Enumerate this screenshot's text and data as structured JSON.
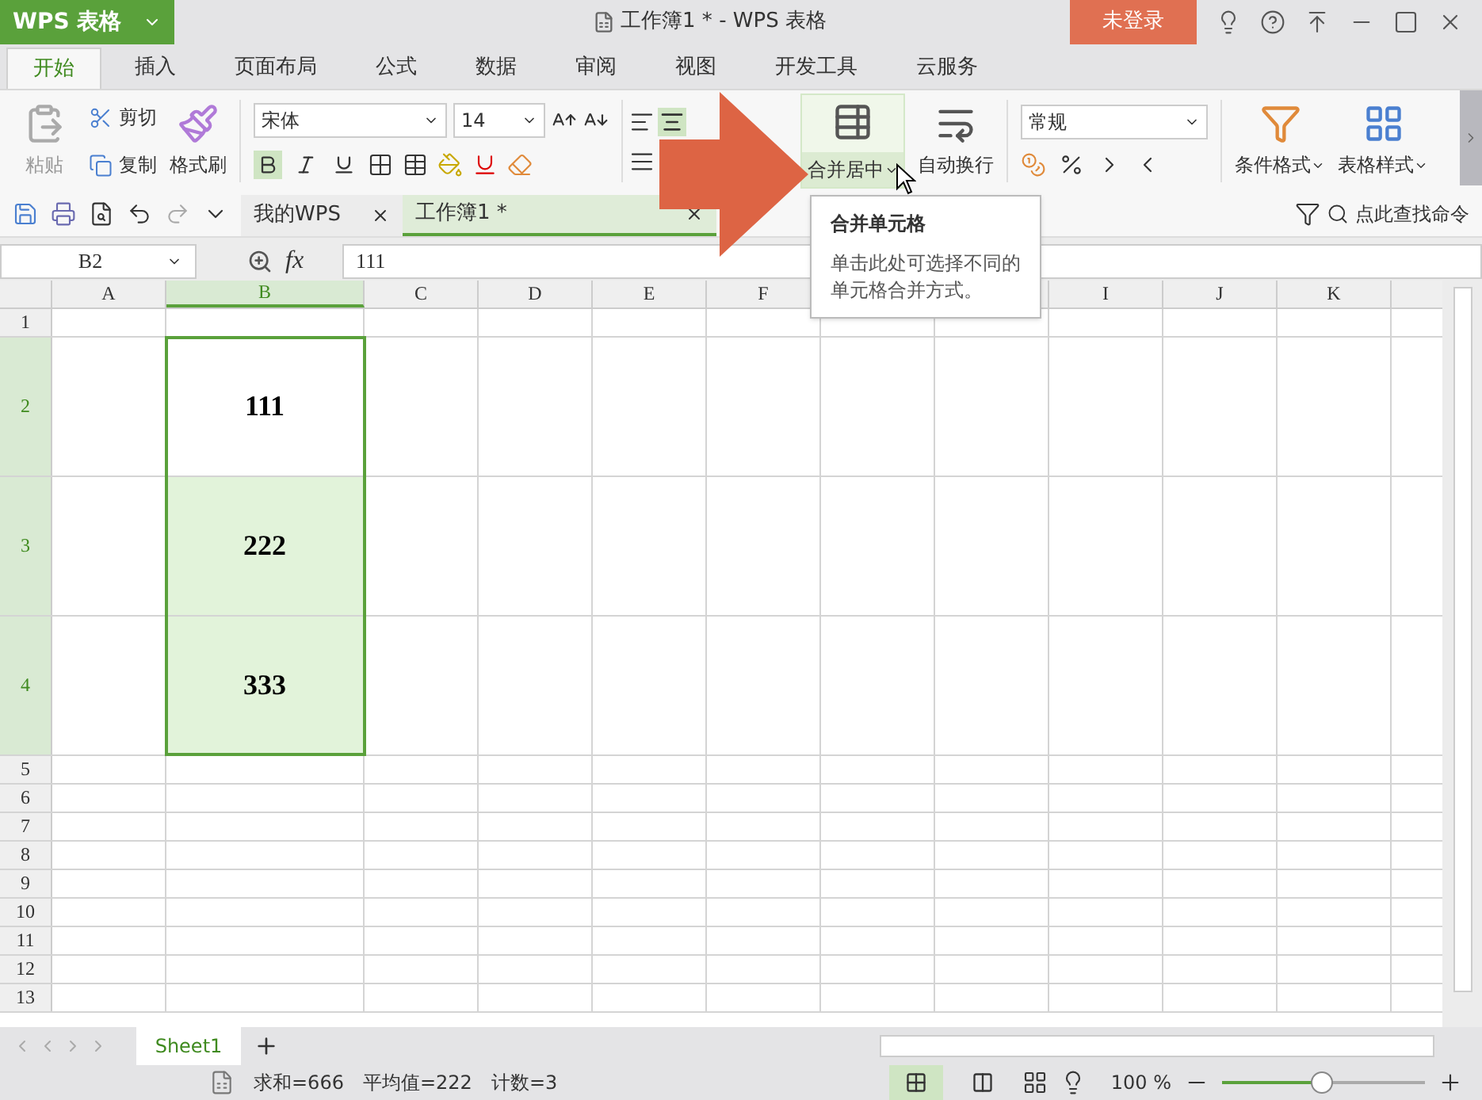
{
  "app_menu": {
    "label": "WPS 表格"
  },
  "window": {
    "title": "工作簿1 * - WPS 表格"
  },
  "login_button": "未登录",
  "ribbon_tabs": [
    {
      "label": "开始",
      "selected": true
    },
    {
      "label": "插入",
      "selected": false
    },
    {
      "label": "页面布局",
      "selected": false
    },
    {
      "label": "公式",
      "selected": false
    },
    {
      "label": "数据",
      "selected": false
    },
    {
      "label": "审阅",
      "selected": false
    },
    {
      "label": "视图",
      "selected": false
    },
    {
      "label": "开发工具",
      "selected": false
    },
    {
      "label": "云服务",
      "selected": false
    }
  ],
  "clipboard": {
    "paste": {
      "label": "粘贴",
      "disabled": true
    },
    "cut": "剪切",
    "copy": "复制",
    "format_painter": "格式刷"
  },
  "font": {
    "name": "宋体",
    "size": "14",
    "bold": true,
    "italic": false,
    "underline": false
  },
  "merge_button": {
    "label": "合并居中",
    "hovered": true
  },
  "wrap_button": "自动换行",
  "number_format": "常规",
  "conditional_format": "条件格式",
  "table_style": "表格样式",
  "doc_tabs": [
    {
      "label": "我的WPS",
      "selected": false
    },
    {
      "label": "工作簿1 *",
      "selected": true
    }
  ],
  "command_search": "点此查找命令",
  "name_box": "B2",
  "fx": "fx",
  "formula": "111",
  "tooltip": {
    "title": "合并单元格",
    "lines": [
      "单击此处可选择不同的",
      "单元格合并方式。"
    ]
  },
  "columns": [
    {
      "label": "A",
      "selected": false
    },
    {
      "label": "B",
      "selected": true
    },
    {
      "label": "C",
      "selected": false
    },
    {
      "label": "D",
      "selected": false
    },
    {
      "label": "E",
      "selected": false
    },
    {
      "label": "F",
      "selected": false
    },
    {},
    {},
    {
      "label": "I",
      "selected": false
    },
    {
      "label": "J",
      "selected": false
    },
    {
      "label": "K",
      "selected": false
    }
  ],
  "rows": [
    {
      "label": "1",
      "selected": false,
      "tall": false
    },
    {
      "label": "2",
      "selected": true,
      "tall": true,
      "b": {
        "value": "111",
        "active": true
      }
    },
    {
      "label": "3",
      "selected": true,
      "tall": true,
      "b": {
        "value": "222",
        "active": false
      }
    },
    {
      "label": "4",
      "selected": true,
      "tall": true,
      "b": {
        "value": "333",
        "active": false
      }
    },
    {
      "label": "5",
      "selected": false,
      "tall": false
    },
    {
      "label": "6",
      "selected": false,
      "tall": false
    },
    {
      "label": "7",
      "selected": false,
      "tall": false
    },
    {
      "label": "8",
      "selected": false,
      "tall": false
    },
    {
      "label": "9",
      "selected": false,
      "tall": false
    },
    {
      "label": "10",
      "selected": false,
      "tall": false
    },
    {
      "label": "11",
      "selected": false,
      "tall": false
    },
    {
      "label": "12",
      "selected": false,
      "tall": false
    },
    {
      "label": "13",
      "selected": false,
      "tall": false
    }
  ],
  "sheet_tabs": [
    {
      "label": "Sheet1",
      "selected": true
    }
  ],
  "status": {
    "items": [
      "求和=666",
      "平均值=222",
      "计数=3"
    ],
    "views": [
      {
        "selected": true
      },
      {
        "selected": false
      }
    ],
    "zoom": "100 %",
    "zoom_slider": {
      "level": 0.49
    }
  }
}
